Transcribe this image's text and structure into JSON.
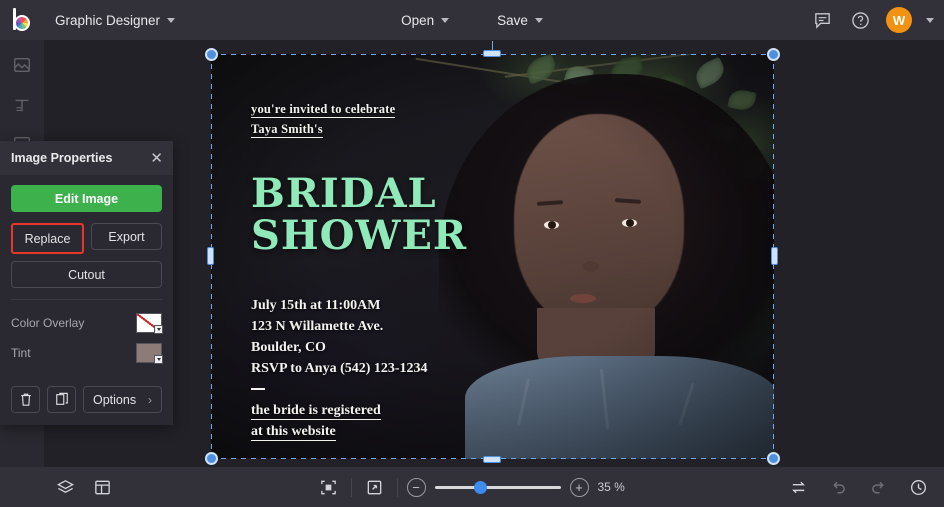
{
  "topbar": {
    "logo_name": "befunky-logo",
    "app_menu_label": "Graphic Designer",
    "open_label": "Open",
    "save_label": "Save",
    "feedback_icon": "chat-bubble-icon",
    "help_icon": "question-circle-icon",
    "avatar_initial": "W",
    "avatar_color": "#f29212"
  },
  "left_toolbar": {
    "items": [
      {
        "name": "image-manager-icon"
      },
      {
        "name": "text-tool-icon"
      },
      {
        "name": "templates-icon"
      }
    ]
  },
  "panel": {
    "title": "Image Properties",
    "close_icon": "close-icon",
    "edit_image_label": "Edit Image",
    "edit_image_color": "#3cb14c",
    "replace_label": "Replace",
    "replace_highlight_color": "#e8362a",
    "export_label": "Export",
    "cutout_label": "Cutout",
    "color_overlay_label": "Color Overlay",
    "color_overlay_value": "none",
    "tint_label": "Tint",
    "tint_value": "#8d7b78",
    "delete_icon": "trash-icon",
    "duplicate_icon": "duplicate-icon",
    "options_label": "Options",
    "options_chevron": "chevron-right-icon"
  },
  "canvas": {
    "selection_color": "#4f8fe0",
    "card": {
      "invite_line_1": "you're invited to celebrate",
      "invite_line_2": "Taya Smith's",
      "headline_line_1": "BRIDAL",
      "headline_line_2": "SHOWER",
      "headline_color": "#8fe9b9",
      "detail_line_1": "July 15th at 11:00AM",
      "detail_line_2": "123 N Willamette Ave.",
      "detail_line_3": "Boulder, CO",
      "detail_line_4": "RSVP to Anya (542) 123-1234",
      "footer_line_1": "the bride is registered ",
      "footer_line_2": "at this website"
    }
  },
  "bottombar": {
    "layers_icon": "layers-icon",
    "layout_icon": "layout-grid-icon",
    "fit_screen_icon": "fit-to-screen-icon",
    "fullscreen_icon": "expand-arrow-icon",
    "zoom_out_label": "−",
    "zoom_in_label": "+",
    "zoom_value": "35 %",
    "zoom_percent": 35,
    "swap_icon": "swap-arrows-icon",
    "undo_icon": "undo-arrow-icon",
    "redo_icon": "redo-arrow-icon",
    "history_icon": "history-clock-icon"
  }
}
